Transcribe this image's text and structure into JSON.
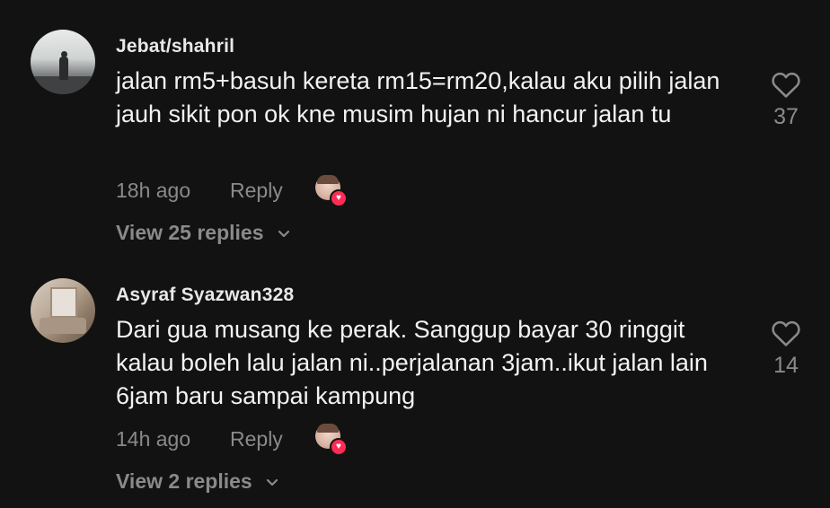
{
  "comments": [
    {
      "username": "Jebat/shahril",
      "text": "jalan rm5+basuh kereta rm15=rm20,kalau aku pilih jalan jauh sikit pon ok kne musim hujan ni hancur jalan tu",
      "time": "18h ago",
      "reply_label": "Reply",
      "view_replies": "View 25 replies",
      "like_count": "37",
      "liked_by_creator": true,
      "avatar_icon": "profile-photo"
    },
    {
      "username": "Asyraf Syazwan328",
      "text": "Dari gua musang ke perak. Sanggup bayar 30 ringgit kalau boleh lalu jalan ni..perjalanan 3jam..ikut jalan lain 6jam baru sampai kampung",
      "time": "14h ago",
      "reply_label": "Reply",
      "view_replies": "View 2 replies",
      "like_count": "14",
      "liked_by_creator": true,
      "avatar_icon": "profile-photo"
    }
  ],
  "colors": {
    "background": "#121212",
    "muted": "#8a8a8a",
    "heart_badge": "#fe2c55"
  }
}
